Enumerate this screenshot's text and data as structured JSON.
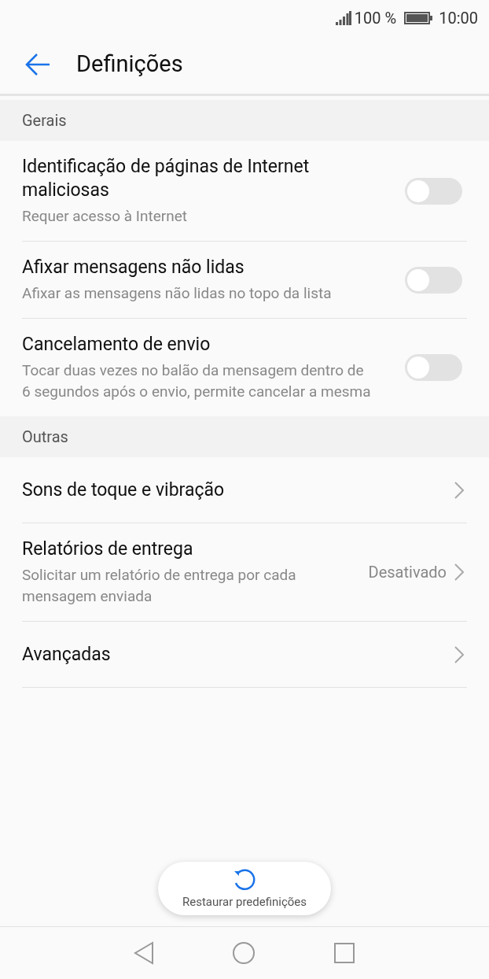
{
  "status_bar": {
    "battery": "100 %",
    "time": "10:00"
  },
  "header": {
    "title": "Definições"
  },
  "sections": [
    {
      "title": "Gerais",
      "items": [
        {
          "kind": "toggle",
          "title": "Identificação de páginas de Internet maliciosas",
          "subtitle": "Requer acesso à Internet",
          "on": false
        },
        {
          "kind": "toggle",
          "title": "Afixar mensagens não lidas",
          "subtitle": "Afixar as mensagens não lidas no topo da lista",
          "on": false
        },
        {
          "kind": "toggle",
          "title": "Cancelamento de envio",
          "subtitle": "Tocar duas vezes no balão da mensagem dentro de 6 segundos após o envio, permite cancelar a mesma",
          "on": false
        }
      ]
    },
    {
      "title": "Outras",
      "items": [
        {
          "kind": "link",
          "title": "Sons de toque e vibração"
        },
        {
          "kind": "link",
          "title": "Relatórios de entrega",
          "subtitle": "Solicitar um relatório de entrega por cada mensagem enviada",
          "value": "Desativado"
        },
        {
          "kind": "link",
          "title": "Avançadas"
        }
      ]
    }
  ],
  "restore_button": {
    "label": "Restaurar predefinições"
  }
}
